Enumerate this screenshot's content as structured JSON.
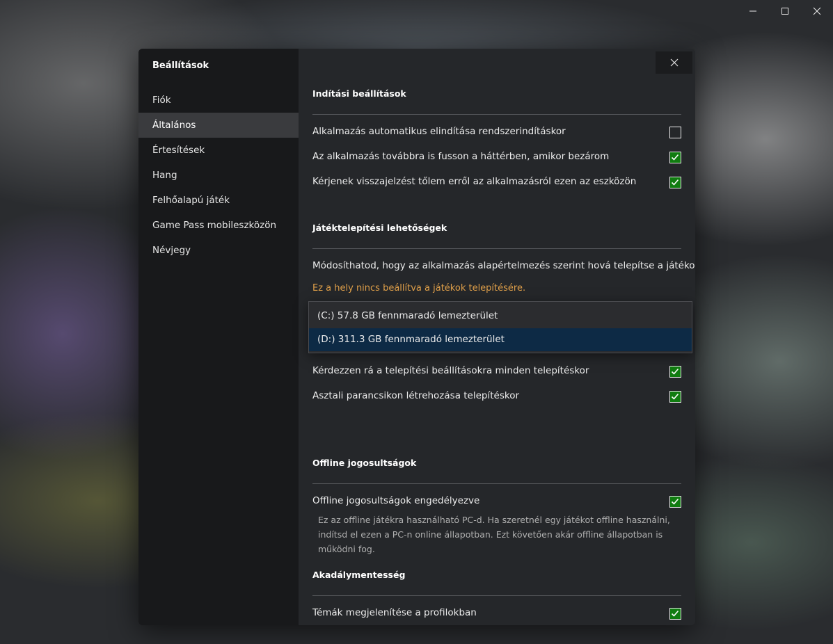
{
  "window": {
    "minimize_icon": "minimize-icon",
    "maximize_icon": "maximize-icon",
    "close_icon": "close-icon"
  },
  "sidebar": {
    "title": "Beállítások",
    "items": [
      {
        "label": "Fiók",
        "active": false
      },
      {
        "label": "Általános",
        "active": true
      },
      {
        "label": "Értesítések",
        "active": false
      },
      {
        "label": "Hang",
        "active": false
      },
      {
        "label": "Felhőalapú játék",
        "active": false
      },
      {
        "label": "Game Pass mobileszközön",
        "active": false
      },
      {
        "label": "Névjegy",
        "active": false
      }
    ]
  },
  "startup": {
    "title": "Indítási beállítások",
    "items": [
      {
        "label": "Alkalmazás automatikus elindítása rendszerindításkor",
        "checked": false
      },
      {
        "label": "Az alkalmazás továbbra is fusson a háttérben, amikor bezárom",
        "checked": true
      },
      {
        "label": "Kérjenek visszajelzést tőlem erről az alkalmazásról ezen az eszközön",
        "checked": true
      }
    ]
  },
  "install": {
    "title": "Játéktelepítési lehetőségek",
    "description": "Módosíthatod, hogy az alkalmazás alapértelmezés szerint hová telepítse a játékokat",
    "warning": "Ez a hely nincs beállítva a játékok telepítésére.",
    "dropdown_options": [
      {
        "label": "(C:) 57.8 GB fennmaradó lemezterület",
        "selected": false
      },
      {
        "label": "(D:) 311.3 GB fennmaradó lemezterület",
        "selected": true
      }
    ],
    "items": [
      {
        "label": "Kérdezzen rá a telepítési beállításokra minden telepítéskor",
        "checked": true
      },
      {
        "label": "Asztali parancsikon létrehozása telepítéskor",
        "checked": true
      }
    ]
  },
  "offline": {
    "title": "Offline jogosultságok",
    "items": [
      {
        "label": "Offline jogosultságok engedélyezve",
        "checked": true
      }
    ],
    "description": "Ez az offline játékra használható PC-d. Ha szeretnél egy játékot offline használni, indítsd el ezen a PC-n online állapotban. Ezt követően akár offline állapotban is működni fog."
  },
  "accessibility": {
    "title": "Akadálymentesség",
    "items": [
      {
        "label": "Témák megjelenítése a profilokban",
        "checked": true
      }
    ]
  },
  "colors": {
    "checkbox_checked": "#107c10",
    "warning_text": "#e0a04a",
    "selected_option": "#0d2a45",
    "active_nav": "#3a3b3e"
  }
}
